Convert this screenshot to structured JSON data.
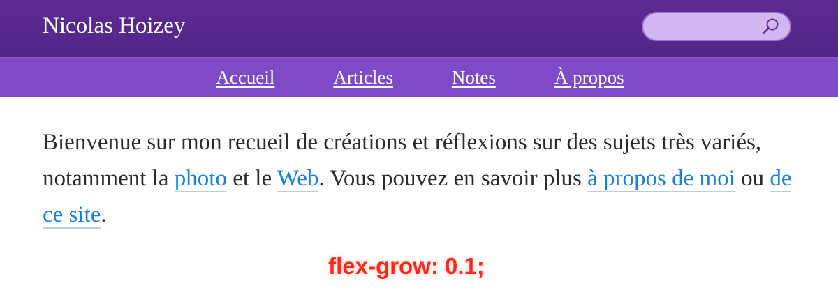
{
  "site": {
    "title": "Nicolas Hoizey"
  },
  "search": {
    "placeholder": "",
    "icon": "search-icon"
  },
  "nav": {
    "items": [
      {
        "label": "Accueil"
      },
      {
        "label": "Articles"
      },
      {
        "label": "Notes"
      },
      {
        "label": "À propos"
      }
    ]
  },
  "intro": {
    "part1": "Bienvenue sur mon recueil de créations et réflexions sur des sujets très variés, notamment la ",
    "link_photo": "photo",
    "part2": " et le ",
    "link_web": "Web",
    "part3": ". Vous pouvez en savoir plus ",
    "link_about_me": "à propos de moi",
    "part4": " ou ",
    "link_about_site": "de ce site",
    "part5": "."
  },
  "annotation": {
    "text": "flex-grow: 0.1;"
  },
  "colors": {
    "header_bg": "#5b2c93",
    "nav_bg": "#7e4bc6",
    "search_bg": "#d3b7f0",
    "link": "#1f7fd6",
    "annotation": "#ff2a1a"
  }
}
